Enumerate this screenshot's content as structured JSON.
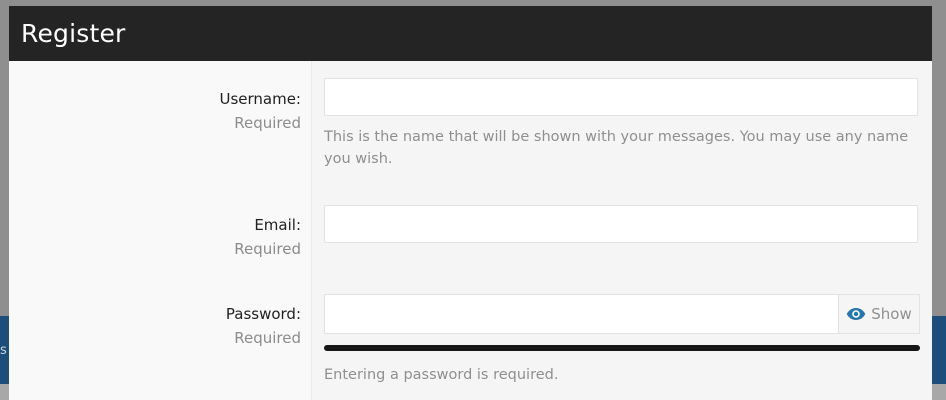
{
  "modal": {
    "title": "Register"
  },
  "background": {
    "edge_text": "s"
  },
  "fields": {
    "username": {
      "label": "Username:",
      "required": "Required",
      "value": "",
      "hint": "This is the name that will be shown with your messages. You may use any name you wish."
    },
    "email": {
      "label": "Email:",
      "required": "Required",
      "value": ""
    },
    "password": {
      "label": "Password:",
      "required": "Required",
      "value": "",
      "show_label": "Show",
      "show_icon": "eye-icon",
      "hint": "Entering a password is required."
    }
  },
  "colors": {
    "header_bg": "#242424",
    "accent": "#1d4d7a",
    "eye_icon": "#2577b1"
  }
}
